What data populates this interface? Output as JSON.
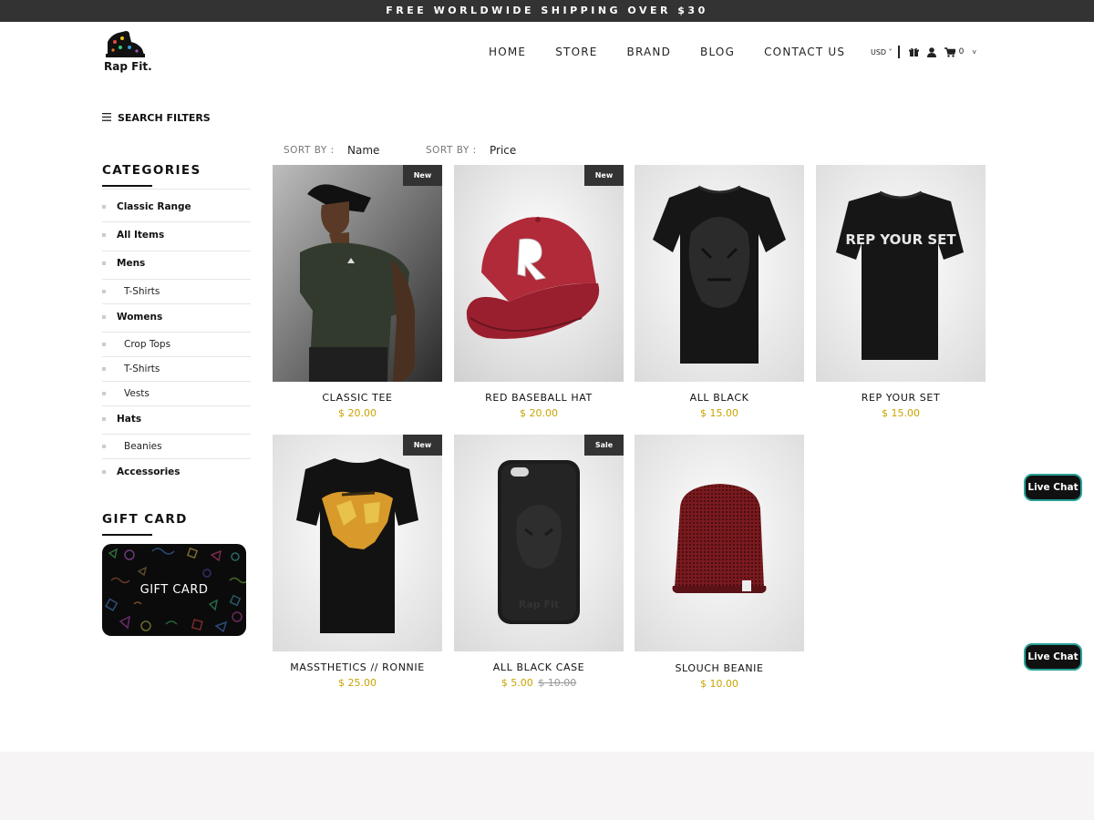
{
  "promo_bar": {
    "text": "FREE WORLDWIDE SHIPPING OVER $30"
  },
  "brand": {
    "name": "Rap Fit.",
    "logo_icon": "sneaker-logo-icon"
  },
  "nav": {
    "items": [
      "HOME",
      "STORE",
      "BRAND",
      "BLOG",
      "CONTACT US"
    ]
  },
  "header_tools": {
    "currency": "USD",
    "cart_count": "0"
  },
  "filters": {
    "label": "SEARCH FILTERS"
  },
  "sort": {
    "label": "SORT BY :",
    "first_value": "Name",
    "second_value": "Price"
  },
  "sidebar": {
    "categories_title": "CATEGORIES",
    "items": [
      {
        "label": "Classic Range",
        "level": "main"
      },
      {
        "label": "All Items",
        "level": "main"
      },
      {
        "label": "Mens",
        "level": "main"
      },
      {
        "label": "T-Shirts",
        "level": "sub"
      },
      {
        "label": "Womens",
        "level": "main"
      },
      {
        "label": "Crop Tops",
        "level": "sub"
      },
      {
        "label": "T-Shirts",
        "level": "sub"
      },
      {
        "label": "Vests",
        "level": "sub"
      },
      {
        "label": "Hats",
        "level": "main"
      },
      {
        "label": "Beanies",
        "level": "sub"
      },
      {
        "label": "Accessories",
        "level": "main"
      }
    ],
    "gift_title": "GIFT CARD",
    "gift_card_label": "GIFT CARD"
  },
  "products": [
    {
      "name": "CLASSIC TEE",
      "price": "$ 20.00",
      "badge": "New"
    },
    {
      "name": "RED BASEBALL HAT",
      "price": "$ 20.00",
      "badge": "New"
    },
    {
      "name": "ALL BLACK",
      "price": "$ 15.00",
      "badge": ""
    },
    {
      "name": "REP YOUR SET",
      "price": "$ 15.00",
      "badge": "",
      "print_text": "REP YOUR SET"
    },
    {
      "name": "MASSTHETICS // RONNIE",
      "price": "$ 25.00",
      "badge": "New"
    },
    {
      "name": "ALL BLACK CASE",
      "price": "$ 5.00",
      "old_price": "$ 10.00",
      "badge": "Sale",
      "case_text": "Rap Fit"
    },
    {
      "name": "SLOUCH BEANIE",
      "price": "$ 10.00",
      "badge": ""
    }
  ],
  "live_chat": {
    "label": "Live Chat"
  },
  "colors": {
    "accent_price": "#c9a400",
    "top_bar": "#333333",
    "badge_bg": "#333333",
    "chat_border": "#2aa198",
    "footer_bg": "#f6f4f4"
  }
}
